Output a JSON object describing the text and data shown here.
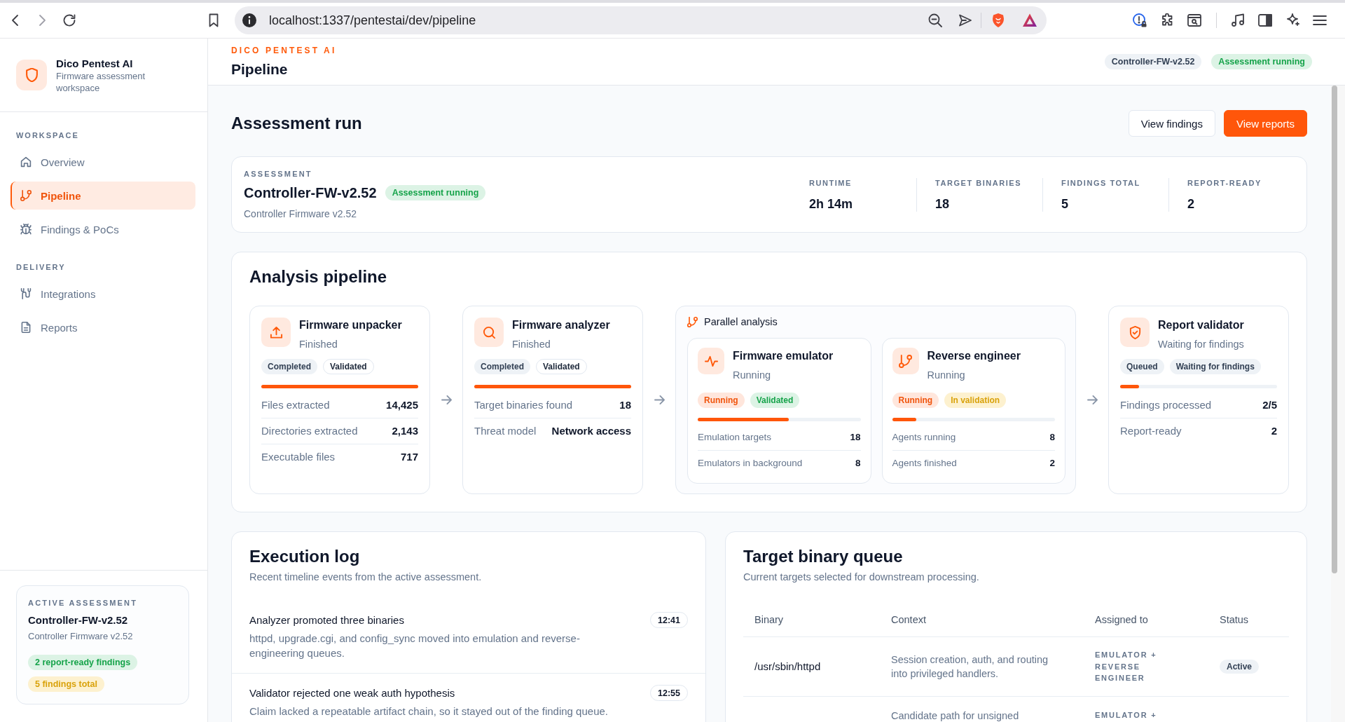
{
  "browser": {
    "url": "localhost:1337/pentestai/dev/pipeline"
  },
  "sidebar": {
    "brand": {
      "name": "Dico Pentest AI",
      "subtitle": "Firmware assessment workspace"
    },
    "sections": [
      {
        "label": "WORKSPACE",
        "items": [
          {
            "label": "Overview",
            "selected": false
          },
          {
            "label": "Pipeline",
            "selected": true
          },
          {
            "label": "Findings & PoCs",
            "selected": false
          }
        ]
      },
      {
        "label": "DELIVERY",
        "items": [
          {
            "label": "Integrations",
            "selected": false
          },
          {
            "label": "Reports",
            "selected": false
          }
        ]
      }
    ],
    "active_assessment": {
      "label": "ACTIVE ASSESSMENT",
      "name": "Controller-FW-v2.52",
      "subtitle": "Controller Firmware v2.52",
      "badges": [
        {
          "label": "2 report-ready findings",
          "kind": "success"
        },
        {
          "label": "5 findings total",
          "kind": "warning"
        }
      ]
    }
  },
  "header": {
    "eyebrow": "DICO PENTEST AI",
    "title": "Pipeline",
    "badges": [
      {
        "label": "Controller-FW-v2.52",
        "kind": "neutral"
      },
      {
        "label": "Assessment running",
        "kind": "success"
      }
    ]
  },
  "page": {
    "title": "Assessment run",
    "buttons": [
      {
        "label": "View findings",
        "kind": "secondary"
      },
      {
        "label": "View reports",
        "kind": "primary"
      }
    ]
  },
  "assessment": {
    "label": "ASSESSMENT",
    "name": "Controller-FW-v2.52",
    "badge": {
      "label": "Assessment running",
      "kind": "success"
    },
    "subtitle": "Controller Firmware v2.52",
    "stats": [
      {
        "label": "RUNTIME",
        "value": "2h 14m"
      },
      {
        "label": "TARGET BINARIES",
        "value": "18"
      },
      {
        "label": "FINDINGS TOTAL",
        "value": "5"
      },
      {
        "label": "REPORT-READY",
        "value": "2"
      }
    ]
  },
  "pipeline": {
    "title": "Analysis pipeline",
    "stages": [
      {
        "kind": "stage",
        "title": "Firmware unpacker",
        "status": "Finished",
        "badges": [
          {
            "label": "Completed",
            "kind": "neutral"
          },
          {
            "label": "Validated",
            "kind": "outline"
          }
        ],
        "level": 1,
        "metrics": [
          {
            "label": "Files extracted",
            "value": "14,425"
          },
          {
            "label": "Directories extracted",
            "value": "2,143"
          },
          {
            "label": "Executable files",
            "value": "717"
          }
        ]
      },
      {
        "kind": "stage",
        "title": "Firmware analyzer",
        "status": "Finished",
        "badges": [
          {
            "label": "Completed",
            "kind": "neutral"
          },
          {
            "label": "Validated",
            "kind": "outline"
          }
        ],
        "level": 1,
        "metrics": [
          {
            "label": "Target binaries found",
            "value": "18"
          },
          {
            "label": "Threat model",
            "value": "Network access"
          }
        ]
      },
      {
        "kind": "parallel",
        "label": "Parallel analysis",
        "stages": [
          {
            "title": "Firmware emulator",
            "status": "Running",
            "badges": [
              {
                "label": "Running",
                "kind": "running"
              },
              {
                "label": "Validated",
                "kind": "success"
              }
            ],
            "level": 0.56,
            "metrics": [
              {
                "label": "Emulation targets",
                "value": "18"
              },
              {
                "label": "Emulators in background",
                "value": "8"
              }
            ]
          },
          {
            "title": "Reverse engineer",
            "status": "Running",
            "badges": [
              {
                "label": "Running",
                "kind": "running"
              },
              {
                "label": "In validation",
                "kind": "warning"
              }
            ],
            "level": 0.15,
            "metrics": [
              {
                "label": "Agents running",
                "value": "8"
              },
              {
                "label": "Agents finished",
                "value": "2"
              }
            ]
          }
        ]
      },
      {
        "kind": "stage",
        "title": "Report validator",
        "status": "Waiting for findings",
        "badges": [
          {
            "label": "Queued",
            "kind": "neutral"
          },
          {
            "label": "Waiting for findings",
            "kind": "neutral"
          }
        ],
        "level": 0.12,
        "metrics": [
          {
            "label": "Findings processed",
            "value": "2/5"
          },
          {
            "label": "Report-ready",
            "value": "2"
          }
        ]
      }
    ]
  },
  "execution_log": {
    "title": "Execution log",
    "subtitle": "Recent timeline events from the active assessment.",
    "entries": [
      {
        "title": "Analyzer promoted three binaries",
        "time": "12:41",
        "description": "httpd, upgrade.cgi, and config_sync moved into emulation and reverse-engineering queues."
      },
      {
        "title": "Validator rejected one weak auth hypothesis",
        "time": "12:55",
        "description": "Claim lacked a repeatable artifact chain, so it stayed out of the finding queue."
      }
    ]
  },
  "binary_queue": {
    "title": "Target binary queue",
    "subtitle": "Current targets selected for downstream processing.",
    "columns": [
      "Binary",
      "Context",
      "Assigned to",
      "Status"
    ],
    "rows": [
      {
        "binary": "/usr/sbin/httpd",
        "context": "Session creation, auth, and routing into privileged handlers.",
        "assigned": "EMULATOR + REVERSE ENGINEER",
        "status": {
          "label": "Active",
          "kind": "neutral"
        }
      },
      {
        "context": "Candidate path for unsigned",
        "assigned": "EMULATOR +"
      }
    ]
  }
}
